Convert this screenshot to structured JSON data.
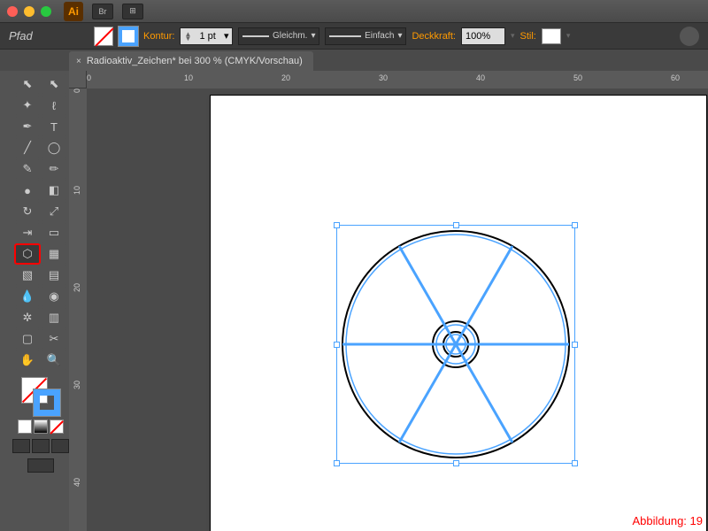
{
  "app_badge": "Ai",
  "title_buttons": {
    "br": "Br",
    "layout": "⊞"
  },
  "path_label": "Pfad",
  "control_bar": {
    "kontur_label": "Kontur:",
    "stroke_weight": "1 pt",
    "profile": "Gleichm.",
    "brush": "Einfach",
    "deckkraft_label": "Deckkraft:",
    "opacity": "100%",
    "stil_label": "Stil:"
  },
  "doc_tab": {
    "close": "×",
    "title": "Radioaktiv_Zeichen* bei 300 % (CMYK/Vorschau)"
  },
  "ruler_h": [
    "0",
    "10",
    "20",
    "30",
    "40",
    "50",
    "60"
  ],
  "ruler_v": [
    "0",
    "10",
    "20",
    "30",
    "40"
  ],
  "caption": "Abbildung: 19",
  "colors": {
    "accent": "#4aa3ff",
    "highlight": "#ff0000",
    "orange": "#ff9a00"
  }
}
